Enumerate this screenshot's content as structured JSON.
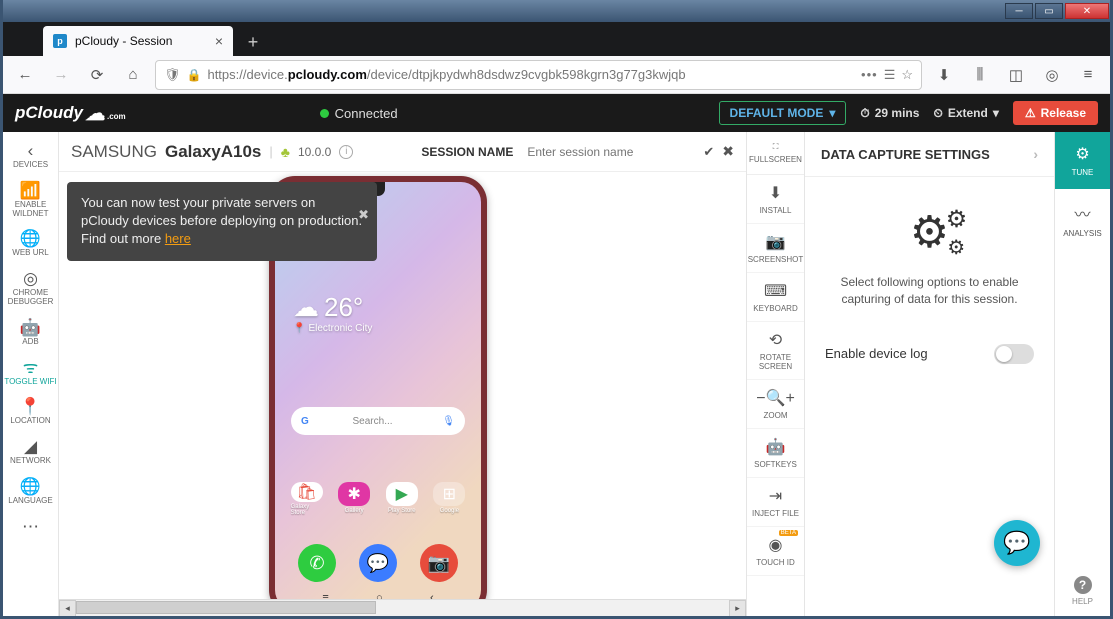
{
  "browser": {
    "tab_title": "pCloudy - Session",
    "url_prefix": "https://device.",
    "url_domain": "pcloudy.com",
    "url_path": "/device/dtpjkpydwh8dsdwz9cvgbk598kgrn3g77g3kwjqb"
  },
  "header": {
    "status": "Connected",
    "mode_label": "DEFAULT MODE",
    "timer": "29 mins",
    "extend": "Extend",
    "release": "Release"
  },
  "leftnav": {
    "devices": "DEVICES",
    "wildnet": "ENABLE WILDNET",
    "weburl": "WEB URL",
    "chrome": "CHROME DEBUGGER",
    "adb": "ADB",
    "wifi": "TOGGLE WIFI",
    "location": "LOCATION",
    "network": "NETWORK",
    "language": "LANGUAGE"
  },
  "device": {
    "brand": "SAMSUNG",
    "model": "GalaxyA10s",
    "version": "10.0.0",
    "session_label": "SESSION NAME",
    "session_placeholder": "Enter session name"
  },
  "tooltip": {
    "text": "You can now test your private servers on pCloudy devices before deploying on production. Find out more ",
    "link": "here"
  },
  "phone": {
    "temp": "26°",
    "city": "Electronic City",
    "search_placeholder": "Search...",
    "apps": {
      "a1": "Galaxy Store",
      "a2": "Gallery",
      "a3": "Play Store",
      "a4": "Google"
    }
  },
  "tools": {
    "fullscreen": "FULLSCREEN",
    "install": "INSTALL",
    "screenshot": "SCREENSHOT",
    "keyboard": "KEYBOARD",
    "rotate": "ROTATE SCREEN",
    "zoom": "ZOOM",
    "softkeys": "SOFTKEYS",
    "inject": "INJECT FILE",
    "touchid": "TOUCH ID",
    "beta": "BETA"
  },
  "right": {
    "tune": "TUNE",
    "analysis": "ANALYSIS",
    "help": "HELP"
  },
  "panel": {
    "title": "DATA CAPTURE SETTINGS",
    "msg": "Select following options to enable capturing of data for this session.",
    "toggle_label": "Enable device log"
  }
}
